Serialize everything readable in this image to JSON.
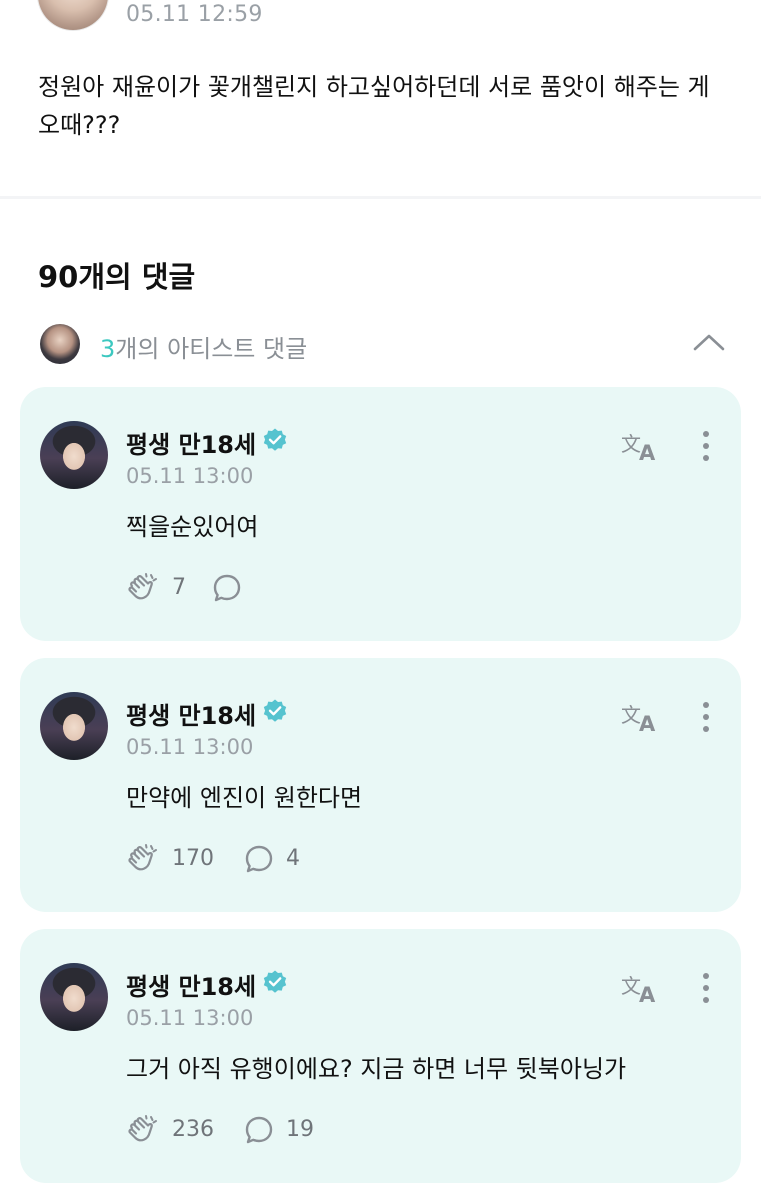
{
  "post": {
    "time": "05.11 12:59",
    "body": "정원아 재윤이가 꽃개챌린지 하고싶어하던데 서로 품앗이 해주는 게 오때???"
  },
  "comments_title": "90개의 댓글",
  "artist_comments": {
    "count": "3",
    "label": "개의 아티스트 댓글"
  },
  "comments": [
    {
      "name": "평생 만18세",
      "time": "05.11 13:00",
      "text": "찍을순있어여",
      "likes": "7",
      "replies": ""
    },
    {
      "name": "평생 만18세",
      "time": "05.11 13:00",
      "text": "만약에 엔진이 원한다면",
      "likes": "170",
      "replies": "4"
    },
    {
      "name": "평생 만18세",
      "time": "05.11 13:00",
      "text": "그거 아직 유행이에요? 지금 하면 너무 뒷북아닝가",
      "likes": "236",
      "replies": "19"
    }
  ],
  "colors": {
    "accent": "#3cc8c0",
    "card_bg": "#e9f8f6",
    "verified": "#56c3cf"
  },
  "icons": {
    "translate": "translate-icon",
    "more": "more-vertical-icon",
    "like": "clap-like-icon",
    "reply": "speech-bubble-icon",
    "verified": "verified-badge-icon",
    "collapse": "chevron-up-icon"
  }
}
